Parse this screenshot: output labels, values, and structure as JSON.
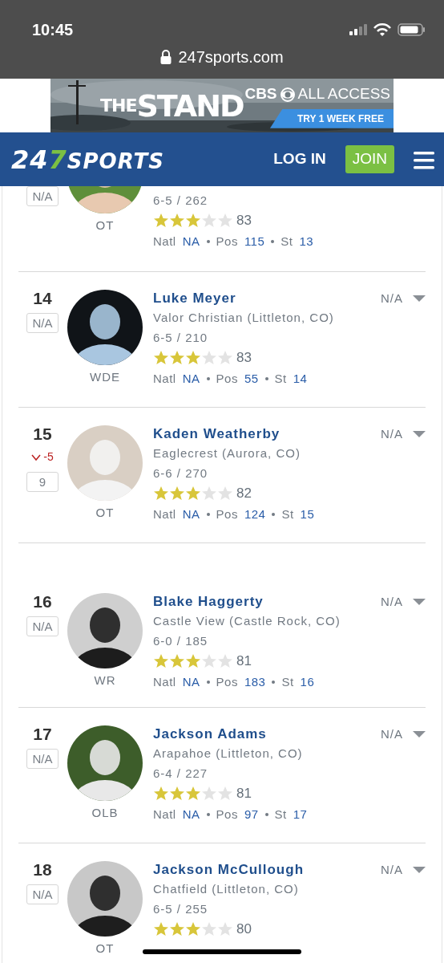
{
  "status_bar": {
    "time": "10:45"
  },
  "address_bar": {
    "url": "247sports.com"
  },
  "ad": {
    "title_small": "THE",
    "title_large": "STAND",
    "brand": "CBS",
    "brand_suffix": "ALL ACCESS",
    "cta": "TRY 1 WEEK FREE"
  },
  "navbar": {
    "logo": [
      {
        "text": "24",
        "accent": false
      },
      {
        "text": "7",
        "accent": true
      },
      {
        "text": "SPORTS",
        "accent": false
      }
    ],
    "login": "LOG IN",
    "join": "JOIN"
  },
  "players": [
    {
      "kind": "partial",
      "rating_box": "N/A",
      "position": "OT",
      "height_weight": "6-5 / 262",
      "stars": 3,
      "rating": "83",
      "ranks": [
        {
          "label": "Natl",
          "value": "NA"
        },
        {
          "label": "Pos",
          "value": "115"
        },
        {
          "label": "St",
          "value": "13"
        }
      ]
    },
    {
      "kind": "full",
      "rank": "14",
      "rating_box": "N/A",
      "position": "WDE",
      "name": "Luke Meyer",
      "school": "Valor Christian (Littleton, CO)",
      "height_weight": "6-5 / 210",
      "stars": 3,
      "rating": "83",
      "ranks": [
        {
          "label": "Natl",
          "value": "NA"
        },
        {
          "label": "Pos",
          "value": "55"
        },
        {
          "label": "St",
          "value": "14"
        }
      ],
      "prediction": "N/A"
    },
    {
      "kind": "full",
      "rank": "15",
      "change": {
        "kind": "down",
        "text": "-5"
      },
      "rating_box": "9",
      "position": "OT",
      "name": "Kaden Weatherby",
      "school": "Eaglecrest (Aurora, CO)",
      "height_weight": "6-6 / 270",
      "stars": 3,
      "rating": "82",
      "ranks": [
        {
          "label": "Natl",
          "value": "NA"
        },
        {
          "label": "Pos",
          "value": "124"
        },
        {
          "label": "St",
          "value": "15"
        }
      ],
      "prediction": "N/A"
    },
    {
      "kind": "full",
      "rank": "16",
      "rating_box": "N/A",
      "position": "WR",
      "name": "Blake Haggerty",
      "school": "Castle View (Castle Rock, CO)",
      "height_weight": "6-0 / 185",
      "stars": 3,
      "rating": "81",
      "ranks": [
        {
          "label": "Natl",
          "value": "NA"
        },
        {
          "label": "Pos",
          "value": "183"
        },
        {
          "label": "St",
          "value": "16"
        }
      ],
      "prediction": "N/A"
    },
    {
      "kind": "full",
      "rank": "17",
      "rating_box": "N/A",
      "position": "OLB",
      "name": "Jackson Adams",
      "school": "Arapahoe (Littleton, CO)",
      "height_weight": "6-4 / 227",
      "stars": 3,
      "rating": "81",
      "ranks": [
        {
          "label": "Natl",
          "value": "NA"
        },
        {
          "label": "Pos",
          "value": "97"
        },
        {
          "label": "St",
          "value": "17"
        }
      ],
      "prediction": "N/A"
    },
    {
      "kind": "full",
      "rank": "18",
      "rating_box": "N/A",
      "position": "OT",
      "name": "Jackson McCullough",
      "school": "Chatfield (Littleton, CO)",
      "height_weight": "6-5 / 255",
      "stars": 3,
      "rating": "80",
      "prediction": "N/A"
    }
  ]
}
